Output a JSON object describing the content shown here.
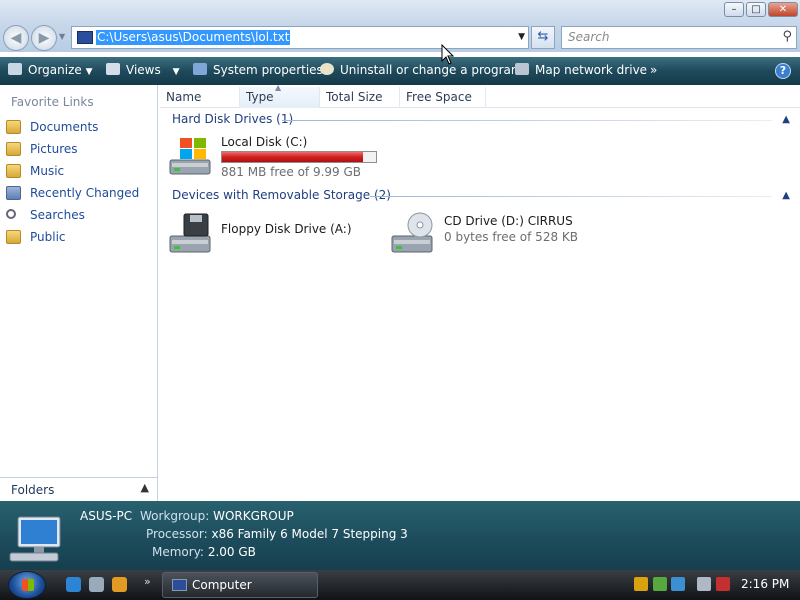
{
  "window": {
    "controls": {
      "minimize": "–",
      "maximize": "□",
      "close": "✕"
    }
  },
  "address": {
    "path": "C:\\Users\\asus\\Documents\\lol.txt",
    "search_placeholder": "Search"
  },
  "commands": {
    "organize": "Organize",
    "views": "Views",
    "system_properties": "System properties",
    "uninstall": "Uninstall or change a program",
    "map_drive": "Map network drive",
    "more": "»",
    "help": "?"
  },
  "sidebar": {
    "title": "Favorite Links",
    "items": [
      {
        "label": "Documents",
        "icon": "documents-folder-icon"
      },
      {
        "label": "Pictures",
        "icon": "pictures-folder-icon"
      },
      {
        "label": "Music",
        "icon": "music-folder-icon"
      },
      {
        "label": "Recently Changed",
        "icon": "recent-folder-icon"
      },
      {
        "label": "Searches",
        "icon": "search-icon"
      },
      {
        "label": "Public",
        "icon": "public-folder-icon"
      }
    ],
    "folders_label": "Folders"
  },
  "columns": [
    "Name",
    "Type",
    "Total Size",
    "Free Space"
  ],
  "groups": {
    "hard_disks": {
      "title": "Hard Disk Drives (1)",
      "drives": [
        {
          "name": "Local Disk (C:)",
          "free_text": "881 MB free of 9.99 GB",
          "used_fraction": 0.914
        }
      ]
    },
    "removable": {
      "title": "Devices with Removable Storage (2)",
      "drives": [
        {
          "name": "Floppy Disk Drive (A:)",
          "free_text": ""
        },
        {
          "name": "CD Drive (D:) CIRRUS",
          "free_text": "0 bytes free of 528 KB"
        }
      ]
    }
  },
  "details": {
    "computer_name": "ASUS-PC",
    "workgroup_label": "Workgroup:",
    "workgroup": "WORKGROUP",
    "processor_label": "Processor:",
    "processor": "x86 Family 6 Model 7 Stepping 3",
    "memory_label": "Memory:",
    "memory": "2.00 GB"
  },
  "taskbar": {
    "quicklaunch_more": "»",
    "task_label": "Computer",
    "clock": "2:16 PM"
  },
  "colors": {
    "command_bar": "#1f4a5c",
    "details_pane": "#1c4b5b",
    "disk_bar_fill": "#d11f1f",
    "selection": "#3399ff",
    "link": "#1e4c9a"
  }
}
